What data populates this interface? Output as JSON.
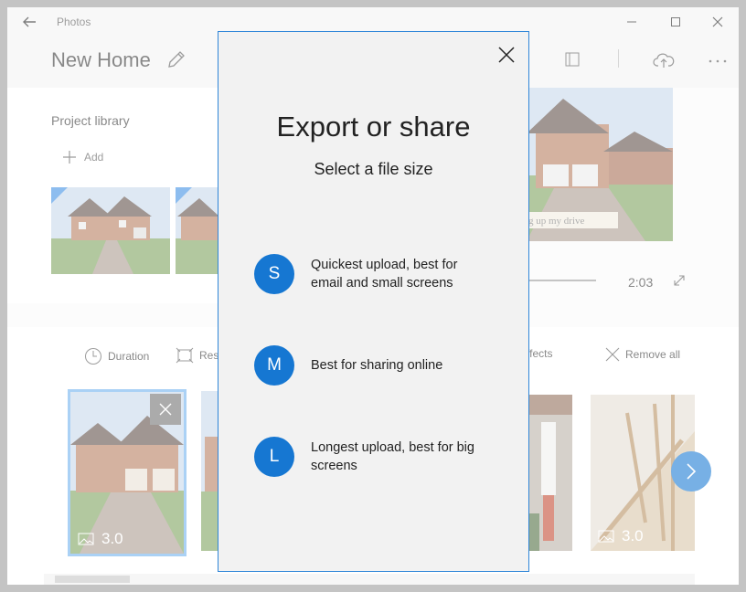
{
  "app": {
    "name": "Photos"
  },
  "header": {
    "project_title": "New Home"
  },
  "library": {
    "title": "Project library",
    "add_label": "Add"
  },
  "preview": {
    "caption": "g up my drive",
    "duration": "2:03"
  },
  "storyboard": {
    "toolbar": {
      "duration_label": "Duration",
      "resize_label": "Res",
      "effects_label": "ffects",
      "remove_all_label": "Remove all"
    },
    "cards": [
      {
        "duration": "3.0"
      },
      {
        "duration": "3.0"
      }
    ]
  },
  "dialog": {
    "title": "Export or share",
    "subtitle": "Select a file size",
    "options": [
      {
        "letter": "S",
        "label": "Quickest upload, best for email and small screens"
      },
      {
        "letter": "M",
        "label": "Best for sharing online"
      },
      {
        "letter": "L",
        "label": "Longest upload, best for big screens"
      }
    ]
  },
  "colors": {
    "accent": "#1677d2",
    "dialog_border": "#2f86d8"
  }
}
